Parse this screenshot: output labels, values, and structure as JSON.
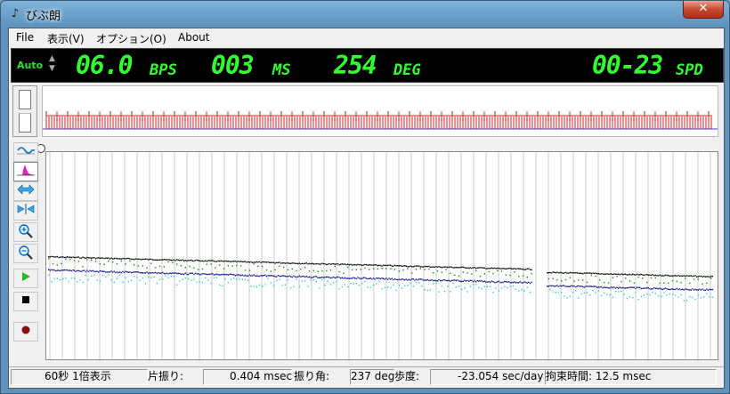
{
  "window": {
    "title": "びぶ朗",
    "close_label": "✕"
  },
  "menu": [
    {
      "label": "File"
    },
    {
      "label": "表示(V)"
    },
    {
      "label": "オプション(O)"
    },
    {
      "label": "About"
    }
  ],
  "lcd": {
    "mode": "Auto",
    "bph_value": "06.0",
    "bph_unit": "BPS",
    "ms_value": "003",
    "ms_unit": "MS",
    "deg_value": "254",
    "deg_unit": "DEG",
    "spd_value": "00-23",
    "spd_unit": "SPD"
  },
  "colors": {
    "lcd_green": "#33ff33",
    "trace_red": "#cc2222",
    "series_black": "#111111",
    "series_green": "#1a8a1a",
    "series_navy": "#1a1a8a",
    "series_cyan": "#33cccc"
  },
  "toolbar": [
    {
      "icon": "waveform-icon",
      "name": "waveform-button"
    },
    {
      "icon": "histogram-icon",
      "name": "histogram-button",
      "active": true
    },
    {
      "icon": "expand-horizontal-icon",
      "name": "expand-horizontal-button"
    },
    {
      "icon": "shrink-horizontal-icon",
      "name": "shrink-horizontal-button"
    },
    {
      "icon": "zoom-in-icon",
      "name": "zoom-in-button"
    },
    {
      "icon": "zoom-out-icon",
      "name": "zoom-out-button"
    },
    {
      "icon": "play-icon",
      "name": "play-button"
    },
    {
      "icon": "stop-icon",
      "name": "stop-button"
    },
    {
      "icon": "record-icon",
      "name": "record-button"
    }
  ],
  "status": {
    "range": "60秒 1倍表示",
    "amplitude_label": "片振り:",
    "amplitude_value": "0.404 msec",
    "swing_label": "振り角:",
    "swing_value": "237 deg",
    "rate_label": "歩度:",
    "rate_value": "-23.054 sec/day",
    "lock_label": "拘束時間: 12.5 msec"
  }
}
